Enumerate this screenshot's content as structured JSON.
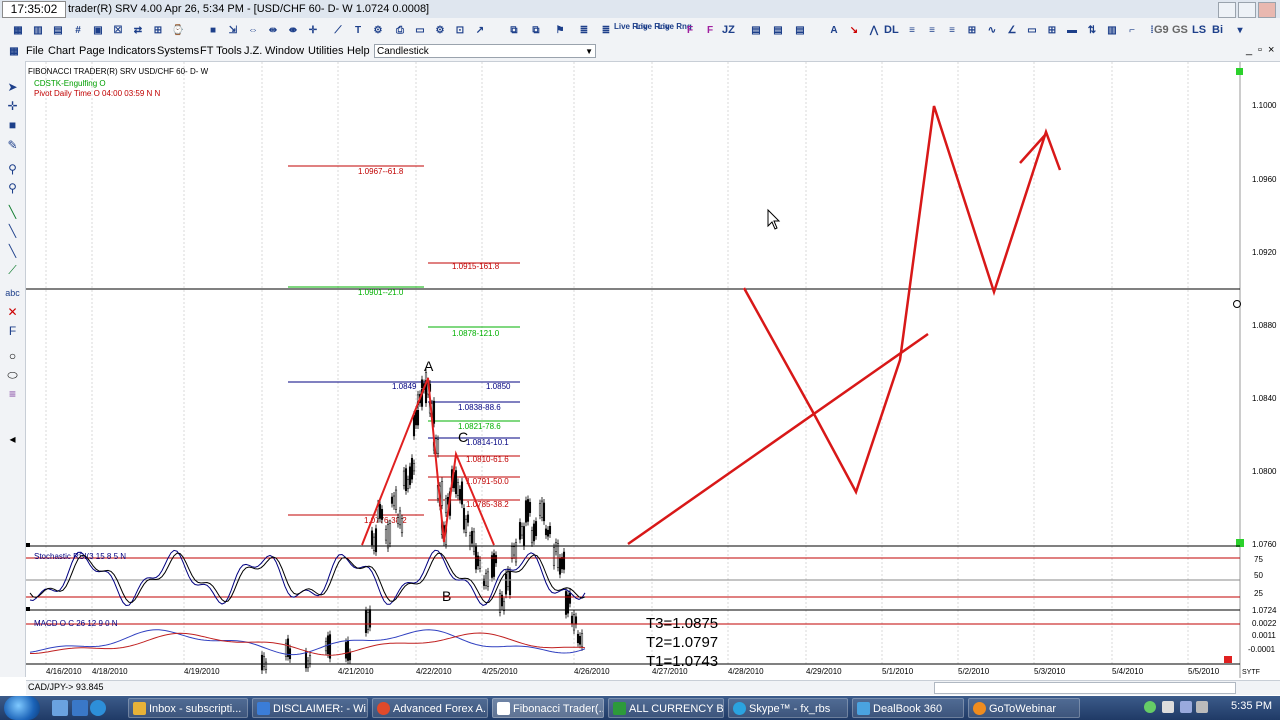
{
  "titlebar": {
    "clock": "17:35:02",
    "title": "trader(R) SRV 4.00 Apr 26,  5:34 PM - [USD/CHF 60- D- W 1.0724   0.0008]"
  },
  "toolbar": {
    "text_buttons": [
      "JZ",
      "DL",
      "LS",
      "Bi",
      "G9",
      "GS",
      "Live Rng",
      "Live Rng",
      "Live Rng"
    ]
  },
  "menu": {
    "items": [
      "File",
      "Chart",
      "Page",
      "Indicators",
      "Systems",
      "FT Tools",
      "J.Z.",
      "Window",
      "Utilities",
      "Help"
    ],
    "chart_type": "Candlestick"
  },
  "chart": {
    "header": "FIBONACCI TRADER(R) SRV     USD/CHF 60- D- W",
    "study_1": "CDSTK-Engulfing O",
    "study_2": "Pivot Daily Time O 04:00 03:59 N N",
    "price_labels": [
      "1.1000",
      "1.0960",
      "1.0920",
      "1.0880",
      "1.0840",
      "1.0800",
      "1.0760",
      "1.0724"
    ],
    "stoch_levels": [
      "75",
      "50",
      "25"
    ],
    "macd_levels": [
      "0.0022",
      "0.0011",
      "-0.0001"
    ],
    "date_labels": [
      "4/16/2010",
      "4/18/2010",
      "4/19/2010",
      "4/21/2010",
      "4/22/2010",
      "4/25/2010",
      "4/26/2010",
      "4/27/2010",
      "4/28/2010",
      "4/29/2010",
      "5/1/2010",
      "5/2/2010",
      "5/3/2010",
      "5/4/2010",
      "5/5/2010"
    ],
    "fib_labels": [
      {
        "text": "1.0967--61.8",
        "color": "#c00000"
      },
      {
        "text": "1.0915-161.8",
        "color": "#c00000"
      },
      {
        "text": "1.0901--21.0",
        "color": "#00b000"
      },
      {
        "text": "1.0878-121.0",
        "color": "#00b000"
      },
      {
        "text": "1.0849",
        "color": "#000080"
      },
      {
        "text": "1.0850",
        "color": "#000080"
      },
      {
        "text": "1.0838-88.6",
        "color": "#000080"
      },
      {
        "text": "1.0821-78.6",
        "color": "#00b000"
      },
      {
        "text": "1.0814-10.1",
        "color": "#000080"
      },
      {
        "text": "1.0810-61.6",
        "color": "#c00000"
      },
      {
        "text": "1.0791-50.0",
        "color": "#c00000"
      },
      {
        "text": "1.0785-38.2",
        "color": "#c00000"
      },
      {
        "text": "1.0776-38.2",
        "color": "#c00000"
      }
    ],
    "wave_labels": [
      "A",
      "B",
      "C"
    ],
    "stoch_label": "Stochastic RSI(3 15 8 5 N",
    "macd_label": "MACD O C 26 12 9 0 N",
    "targets": [
      "T3=1.0875",
      "T2=1.0797",
      "T1=1.0743"
    ],
    "corner_label": "SYTF"
  },
  "status": {
    "text": "CAD/JPY->  93.845"
  },
  "taskbar": {
    "buttons": [
      {
        "label": "Inbox - subscripti...",
        "color": "#e7b238"
      },
      {
        "label": "DISCLAIMER: - Wi...",
        "color": "#3b7dd8"
      },
      {
        "label": "Advanced Forex A...",
        "color": "#e04a2b"
      },
      {
        "label": "Fibonacci Trader(...",
        "color": "#ffffff"
      },
      {
        "label": "ALL CURRENCY BI...",
        "color": "#2d9a3a"
      },
      {
        "label": "Skype™ - fx_rbs",
        "color": "#2aa3e0"
      },
      {
        "label": "DealBook 360",
        "color": "#4aa3e0"
      },
      {
        "label": "GoToWebinar",
        "color": "#f08c1e"
      }
    ],
    "time": "5:35 PM"
  }
}
